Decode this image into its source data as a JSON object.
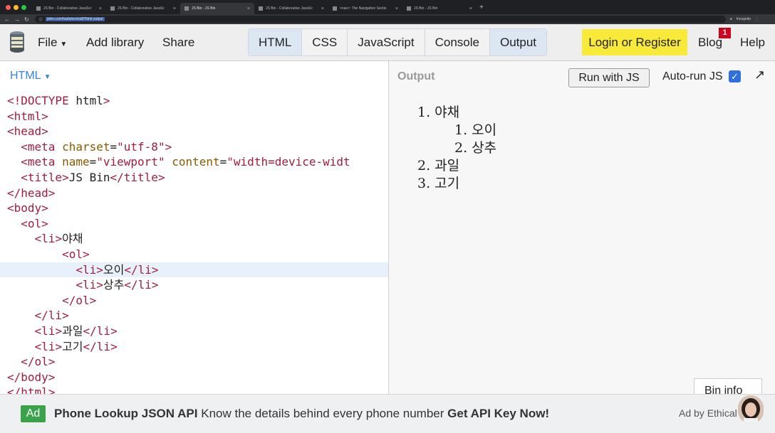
{
  "browser": {
    "tabs": [
      {
        "title": "JS Bin - Collaborative JavaScr",
        "active": false
      },
      {
        "title": "JS Bin - Collaborative JavaSc",
        "active": false
      },
      {
        "title": "JS Bin - JS Bin",
        "active": true
      },
      {
        "title": "JS Bin - Collaborative JavaSc",
        "active": false
      },
      {
        "title": "<nav>: The Navigation Sectio",
        "active": false
      },
      {
        "title": "JS Bin - JS Bin",
        "active": false
      }
    ],
    "url": "jsbin.com/haduloro/edit?html,output",
    "profile_label": "Incognito"
  },
  "toolbar": {
    "file_label": "File",
    "add_library_label": "Add library",
    "share_label": "Share",
    "panels": [
      {
        "label": "HTML",
        "active": true
      },
      {
        "label": "CSS",
        "active": false
      },
      {
        "label": "JavaScript",
        "active": false
      },
      {
        "label": "Console",
        "active": false
      },
      {
        "label": "Output",
        "active": true
      }
    ],
    "login_label": "Login or Register",
    "blog_label": "Blog",
    "blog_badge": "1",
    "help_label": "Help"
  },
  "editor": {
    "language_label": "HTML",
    "lines": [
      "<!DOCTYPE html>",
      "<html>",
      "<head>",
      "  <meta charset=\"utf-8\">",
      "  <meta name=\"viewport\" content=\"width=device-widt",
      "  <title>JS Bin</title>",
      "</head>",
      "<body>",
      "  <ol>",
      "    <li>야채",
      "        <ol>",
      "          <li>오이</li>",
      "          <li>상추</li>",
      "        </ol>",
      "    </li>",
      "    <li>과일</li>",
      "    <li>고기</li>",
      "  </ol>",
      "</body>",
      "</html>"
    ],
    "highlighted_line": 11
  },
  "output": {
    "label": "Output",
    "run_button_label": "Run with JS",
    "autorun_label": "Auto-run JS",
    "autorun_checked": true,
    "list": [
      {
        "marker": "1.",
        "text": "야채",
        "level": 0
      },
      {
        "marker": "1.",
        "text": "오이",
        "level": 1
      },
      {
        "marker": "2.",
        "text": "상추",
        "level": 1
      },
      {
        "marker": "2.",
        "text": "과일",
        "level": 0
      },
      {
        "marker": "3.",
        "text": "고기",
        "level": 0
      }
    ],
    "bin_info_label": "Bin info"
  },
  "ad": {
    "tag": "Ad",
    "title": "Phone Lookup JSON API",
    "body": "Know the details behind every phone number",
    "cta": "Get API Key Now!",
    "by_label": "Ad by Ethical"
  },
  "colors": {
    "accent_blue": "#3584e4",
    "login_yellow": "#f9ea3a",
    "badge_red": "#d0021b",
    "ad_green": "#3aa34a",
    "code_tag": "#a11d3f",
    "code_attr": "#8a5a00"
  }
}
